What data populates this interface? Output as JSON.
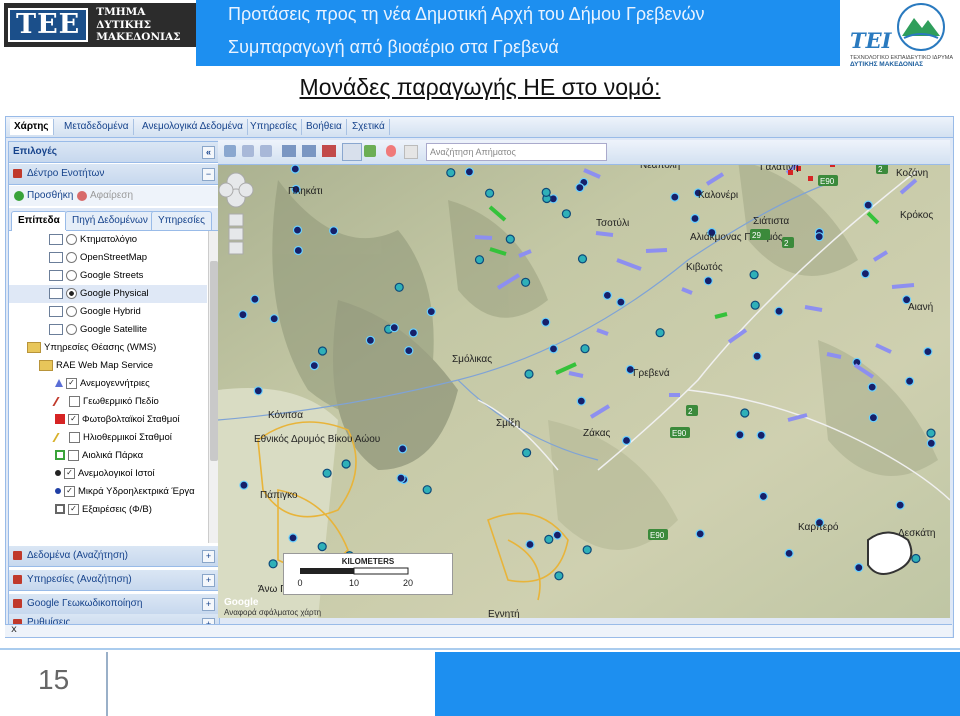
{
  "header": {
    "left_logo_mark": "ΤΕΕ",
    "left_logo_lines": [
      "ΤΜΗΜΑ",
      "ΔΥΤΙΚΗΣ",
      "ΜΑΚΕΔΟΝΙΑΣ"
    ],
    "banner_line1": "Προτάσεις προς τη νέα Δημοτική Αρχή του Δήμου Γρεβενών",
    "banner_line2": "Συμπαραγωγή από βιοαέριο στα Γρεβενά",
    "right_logo_mark": "TEI",
    "right_logo_lines": [
      "ΤΕΧΝΟΛΟΓΙΚΟ ΕΚΠΑΙΔΕΥΤΙΚΟ ΙΔΡΥΜΑ",
      "ΔΥΤΙΚΗΣ ΜΑΚΕΔΟΝΙΑΣ"
    ]
  },
  "slide_title": "Μονάδες παραγωγής ΗΕ στο νομό:",
  "app_tabs": [
    "Χάρτης",
    "Μεταδεδομένα",
    "Ανεμολογικά Δεδομένα",
    "Υπηρεσίες",
    "Βοήθεια",
    "Σχετικά"
  ],
  "left_panel": {
    "title": "Επιλογές",
    "tree_section": "Δέντρο Ενοτήτων",
    "add_label": "Προσθήκη",
    "remove_label": "Αφαίρεση",
    "subtabs": [
      "Επίπεδα",
      "Πηγή Δεδομένων",
      "Υπηρεσίες"
    ],
    "layers": [
      {
        "label": "Κτηματολόγιο",
        "kind": "radio",
        "checked": false
      },
      {
        "label": "OpenStreetMap",
        "kind": "radio",
        "checked": false
      },
      {
        "label": "Google Streets",
        "kind": "radio",
        "checked": false
      },
      {
        "label": "Google Physical",
        "kind": "radio",
        "checked": true
      },
      {
        "label": "Google Hybrid",
        "kind": "radio",
        "checked": false
      },
      {
        "label": "Google Satellite",
        "kind": "radio",
        "checked": false
      },
      {
        "label": "Υπηρεσίες Θέασης (WMS)",
        "kind": "folder"
      },
      {
        "label": "RAE Web Map Service",
        "kind": "folder"
      },
      {
        "label": "Ανεμογεννήτριες",
        "kind": "check",
        "checked": true,
        "icon": "triangle-icon"
      },
      {
        "label": "Γεωθερμικό Πεδίο",
        "kind": "check",
        "checked": false,
        "icon": "red-slash-icon"
      },
      {
        "label": "Φωτοβολταϊκοί Σταθμοί",
        "kind": "check",
        "checked": true,
        "icon": "red-square-icon"
      },
      {
        "label": "Ηλιοθερμικοί Σταθμοί",
        "kind": "check",
        "checked": false,
        "icon": "yellow-slash-icon"
      },
      {
        "label": "Αιολικά Πάρκα",
        "kind": "check",
        "checked": false,
        "icon": "green-square-icon"
      },
      {
        "label": "Ανεμολογικοί Ιστοί",
        "kind": "check",
        "checked": true,
        "icon": "dot-icon"
      },
      {
        "label": "Μικρά Υδροηλεκτρικά Έργα",
        "kind": "check",
        "checked": true,
        "icon": "blue-dot-icon"
      },
      {
        "label": "Εξαιρέσεις (Φ/Β)",
        "kind": "check",
        "checked": true,
        "icon": "grey-square-icon"
      }
    ],
    "bottom_sections": [
      "Δεδομένα (Αναζήτηση)",
      "Υπηρεσίες (Αναζήτηση)",
      "Google Γεωκωδικοποίηση",
      "Ρυθμίσεις"
    ]
  },
  "map": {
    "search_placeholder": "Αναζήτηση Απήματος",
    "places": [
      "Νεάπολη",
      "Καλονέρι",
      "Σιάτιστα",
      "Τσοτύλι",
      "Αλιάκμονας Ποταμός",
      "Κιβωτός",
      "Γαλατινή",
      "Κοζάνη",
      "Κρόκος",
      "Αιανή",
      "Πληκάτι",
      "Σμόλικας",
      "Γρεβενά",
      "Σμίξη",
      "Ζάκας",
      "Κόνιτσα",
      "Εθνικός Δρυμός Βίκου Αώου",
      "Πάπιγκο",
      "Καρπερό",
      "Δεσκάτη",
      "Τσεπέλοβο",
      "Άνω Πεδινά",
      "Εγνητή"
    ],
    "road_badges": [
      "E90",
      "29",
      "2",
      "2",
      "E90",
      "2",
      "E90"
    ],
    "scale_title": "KILOMETERS",
    "scale_ticks": [
      "0",
      "10",
      "20"
    ],
    "attribution": "Google",
    "map_data_label": "Αναφορά σφάλματος χάρτη"
  },
  "bottom_bar_label": "x",
  "footer": {
    "page_number": "15"
  }
}
